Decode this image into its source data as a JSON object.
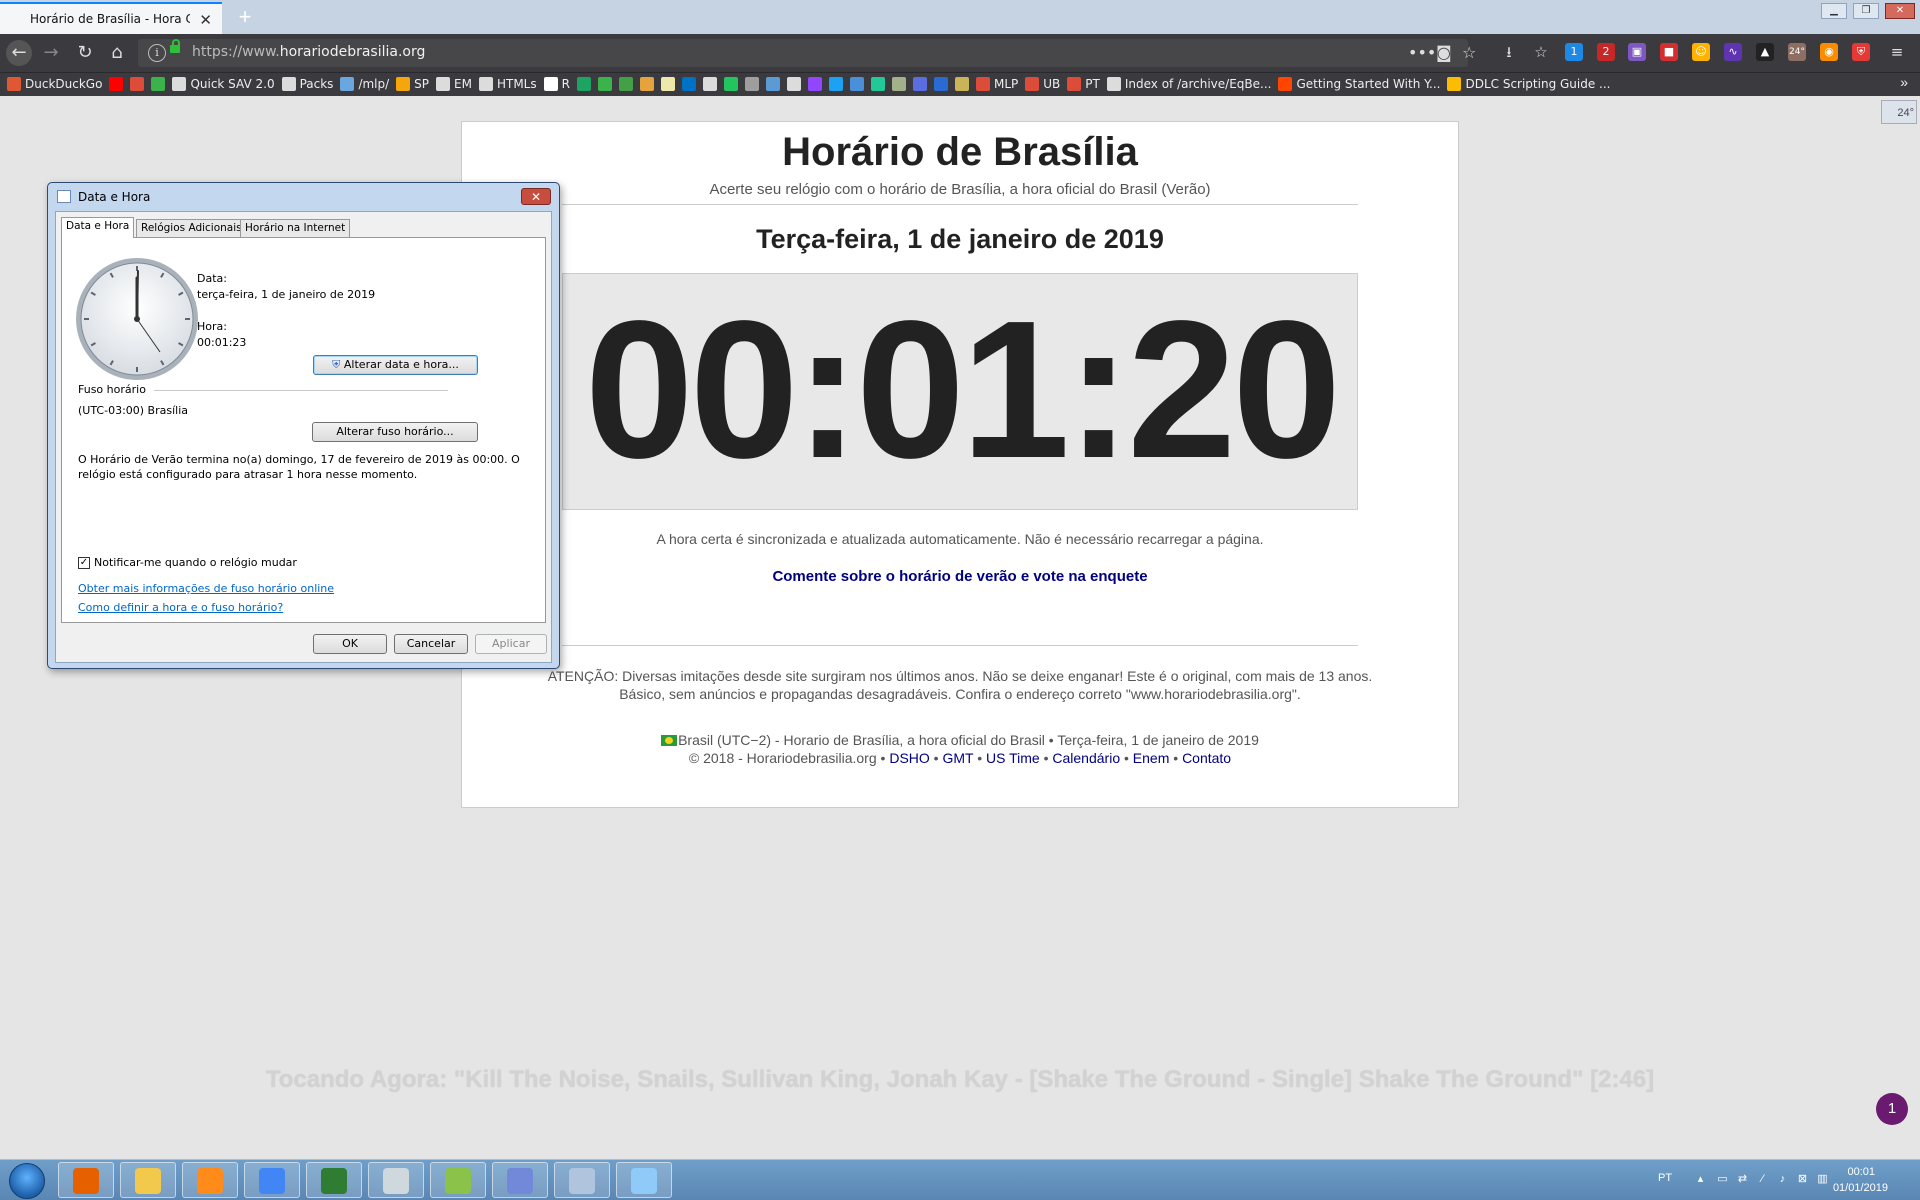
{
  "browser": {
    "tab_title": "Horário de Brasília - Hora Certa",
    "url_prefix": "https://www.",
    "url_domain": "horariodebrasilia.org",
    "bookmarks": [
      {
        "label": "DuckDuckGo",
        "color": "#de5833"
      },
      {
        "label": "",
        "color": "#ff0000"
      },
      {
        "label": "",
        "color": "#dd4b39"
      },
      {
        "label": "",
        "color": "#3bb34a"
      },
      {
        "label": "Quick SAV 2.0",
        "color": "#dcdcdc"
      },
      {
        "label": "Packs",
        "color": "#dcdcdc"
      },
      {
        "label": "/mlp/",
        "color": "#6aa6e0"
      },
      {
        "label": "SP",
        "color": "#f4a60b"
      },
      {
        "label": "EM",
        "color": "#dcdcdc"
      },
      {
        "label": "HTMLs",
        "color": "#dcdcdc"
      },
      {
        "label": "R",
        "color": "#ffffff"
      },
      {
        "label": "",
        "color": "#1da462"
      },
      {
        "label": "",
        "color": "#3bb34a"
      },
      {
        "label": "",
        "color": "#43a047"
      },
      {
        "label": "",
        "color": "#e6a23c"
      },
      {
        "label": "",
        "color": "#eee8aa"
      },
      {
        "label": "",
        "color": "#0072c6"
      },
      {
        "label": "",
        "color": "#dcdcdc"
      },
      {
        "label": "",
        "color": "#22c55e"
      },
      {
        "label": "",
        "color": "#9e9e9e"
      },
      {
        "label": "",
        "color": "#5b9bd5"
      },
      {
        "label": "",
        "color": "#dcdcdc"
      },
      {
        "label": "",
        "color": "#9146ff"
      },
      {
        "label": "",
        "color": "#1da1f2"
      },
      {
        "label": "",
        "color": "#4a90d9"
      },
      {
        "label": "",
        "color": "#20c997"
      },
      {
        "label": "",
        "color": "#a3b18a"
      },
      {
        "label": "",
        "color": "#5b6ee1"
      },
      {
        "label": "",
        "color": "#2a6ad3"
      },
      {
        "label": "",
        "color": "#c9b458"
      },
      {
        "label": "MLP",
        "color": "#dd4b39"
      },
      {
        "label": "UB",
        "color": "#dd4b39"
      },
      {
        "label": "PT",
        "color": "#dd4b39"
      },
      {
        "label": "Index of /archive/EqBe...",
        "color": "#dcdcdc"
      },
      {
        "label": "Getting Started With Y...",
        "color": "#ff4500"
      },
      {
        "label": "DDLC Scripting Guide ...",
        "color": "#fbbc04"
      }
    ],
    "toolbar_badges": {
      "b1": "1",
      "b2": "2",
      "weather": "24°"
    }
  },
  "page": {
    "title": "Horário de Brasília",
    "subtitle": "Acerte seu relógio com o horário de Brasília, a hora oficial do Brasil (Verão)",
    "date": "Terça-feira, 1 de janeiro de 2019",
    "time": "00:01:20",
    "sync_note": "A hora certa é sincronizada e atualizada automaticamente. Não é necessário recarregar a página.",
    "comment_link": "Comente sobre o horário de verão e vote na enquete",
    "warning": "ATENÇÃO: Diversas imitações desde site surgiram nos últimos anos. Não se deixe enganar! Este é o original, com mais de 13 anos. Básico, sem anúncios e propagandas desagradáveis. Confira o endereço correto \"www.horariodebrasilia.org\".",
    "footer_line1": "Brasil (UTC−2) - Horario de Brasília, a hora oficial do Brasil • Terça-feira, 1 de janeiro de 2019",
    "footer_copyright": "© 2018 - Horariodebrasilia.org",
    "footer_links": [
      "DSHO",
      "GMT",
      "US Time",
      "Calendário",
      "Enem",
      "Contato"
    ]
  },
  "dialog": {
    "title": "Data e Hora",
    "close": "✕",
    "tabs": [
      "Data e Hora",
      "Relógios Adicionais",
      "Horário na Internet"
    ],
    "date_label": "Data:",
    "date_value": "terça-feira, 1 de janeiro de 2019",
    "time_label": "Hora:",
    "time_value": "00:01:23",
    "change_datetime_button": "Alterar data e hora...",
    "timezone_heading": "Fuso horário",
    "timezone_value": "(UTC-03:00) Brasília",
    "change_timezone_button": "Alterar fuso horário...",
    "dst_note": "O Horário de Verão termina no(a) domingo, 17 de fevereiro de 2019 às 00:00. O relógio está configurado para atrasar 1 hora nesse momento.",
    "notify_checkbox_label": "Notificar-me quando o relógio mudar",
    "notify_checked": true,
    "link_more_info": "Obter mais informações de fuso horário online",
    "link_how_to": "Como definir a hora e o fuso horário?",
    "ok_button": "OK",
    "cancel_button": "Cancelar",
    "apply_button": "Aplicar"
  },
  "overlay": {
    "now_playing": "Tocando Agora: \"Kill The Noise, Snails, Sullivan King, Jonah Kay - [Shake The Ground - Single] Shake The Ground\" [2:46]",
    "notification_count": "1"
  },
  "taskbar": {
    "apps": [
      {
        "name": "firefox",
        "color": "#e66000"
      },
      {
        "name": "file-explorer",
        "color": "#f2c94c"
      },
      {
        "name": "media-player",
        "color": "#ff8c1a"
      },
      {
        "name": "chrome",
        "color": "#4285f4"
      },
      {
        "name": "terminal",
        "color": "#2e7d32"
      },
      {
        "name": "alien-app",
        "color": "#cfd8dc"
      },
      {
        "name": "notepad-plus",
        "color": "#8bc34a"
      },
      {
        "name": "discord",
        "color": "#7289da"
      },
      {
        "name": "date-time",
        "color": "#b0c4de"
      },
      {
        "name": "notepad",
        "color": "#90caf9"
      }
    ],
    "language": "PT",
    "time": "00:01",
    "date": "01/01/2019"
  }
}
